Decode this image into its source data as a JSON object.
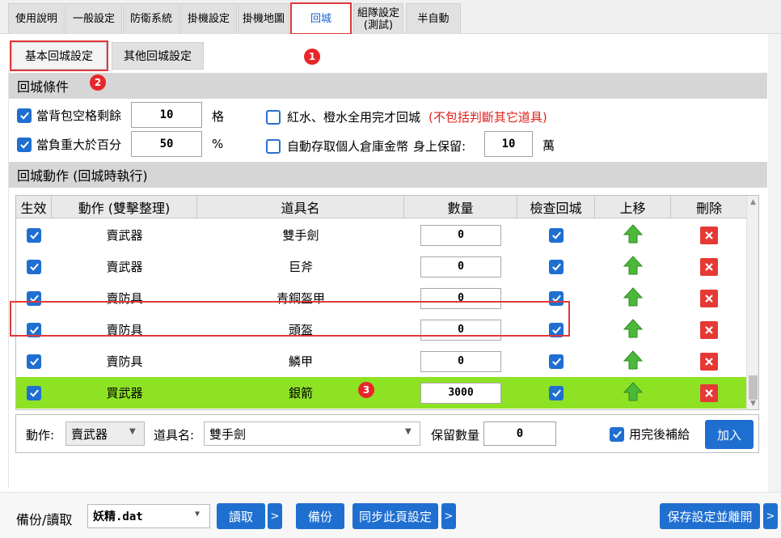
{
  "tabs": [
    {
      "label": "使用說明",
      "active": false
    },
    {
      "label": "一般設定",
      "active": false
    },
    {
      "label": "防衛系統",
      "active": false
    },
    {
      "label": "掛機設定",
      "active": false
    },
    {
      "label": "掛機地圖",
      "active": false
    },
    {
      "label": "回城",
      "active": true
    },
    {
      "label": "組隊設定\n(測試)",
      "active": false
    },
    {
      "label": "半自動",
      "active": false
    }
  ],
  "subtabs": [
    {
      "label": "基本回城設定",
      "active": true
    },
    {
      "label": "其他回城設定",
      "active": false
    }
  ],
  "badges": [
    "1",
    "2",
    "3"
  ],
  "conditions": {
    "title": "回城條件",
    "bag_slots": {
      "label": "當背包空格剩餘",
      "checked": true,
      "value": "10",
      "unit": "格"
    },
    "weight": {
      "label": "當負重大於百分",
      "checked": true,
      "value": "50",
      "unit": "%"
    },
    "potions": {
      "label": "紅水、橙水全用完才回城",
      "checked": false,
      "note": "(不包括判斷其它道具)"
    },
    "bank": {
      "label": "自動存取個人倉庫金幣",
      "checked": false,
      "keep_label": "身上保留:",
      "value": "10",
      "unit": "萬"
    }
  },
  "actions": {
    "title": "回城動作 (回城時執行)",
    "columns": [
      "生效",
      "動作 (雙擊整理)",
      "道具名",
      "數量",
      "檢查回城",
      "上移",
      "刪除"
    ],
    "rows": [
      {
        "enabled": true,
        "action": "賣武器",
        "item": "雙手劍",
        "qty": "0",
        "check": true,
        "selected": false
      },
      {
        "enabled": true,
        "action": "賣武器",
        "item": "巨斧",
        "qty": "0",
        "check": true,
        "selected": false
      },
      {
        "enabled": true,
        "action": "賣防具",
        "item": "青銅盔甲",
        "qty": "0",
        "check": true,
        "selected": false
      },
      {
        "enabled": true,
        "action": "賣防具",
        "item": "頭盔",
        "qty": "0",
        "check": true,
        "selected": false
      },
      {
        "enabled": true,
        "action": "賣防具",
        "item": "鱗甲",
        "qty": "0",
        "check": true,
        "selected": false
      },
      {
        "enabled": true,
        "action": "買武器",
        "item": "銀箭",
        "qty": "3000",
        "check": true,
        "selected": true
      }
    ]
  },
  "add_row": {
    "action_label": "動作:",
    "action_value": "賣武器",
    "item_label": "道具名:",
    "item_value": "雙手劍",
    "keep_label": "保留數量",
    "keep_value": "0",
    "refill_label": "用完後補給",
    "refill_checked": true,
    "add_button": "加入"
  },
  "bottom": {
    "backup_label": "備份/讀取",
    "file_value": "妖精.dat",
    "read_button": "讀取",
    "more_symbol": ">",
    "backup_button": "備份",
    "sync_button": "同步此頁設定",
    "save_button": "保存設定並離開"
  },
  "colors": {
    "accent": "#1f6fd1",
    "highlight": "#8ee224",
    "alert": "#e0383a"
  }
}
